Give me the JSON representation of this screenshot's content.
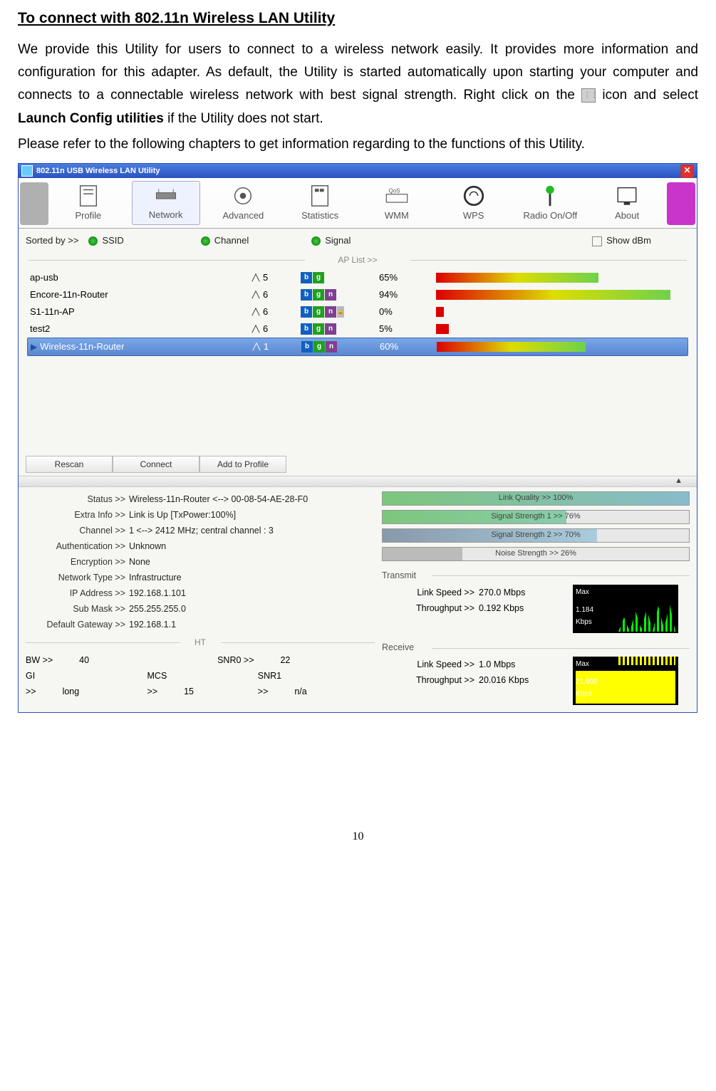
{
  "heading": "To connect with 802.11n Wireless LAN Utility",
  "intro": {
    "p1": "We provide this Utility for users to connect to a wireless network easily. It provides more information and configuration for this adapter. As default, the Utility is started automatically upon starting your computer and connects to a connectable wireless network with best signal strength. Right click on the ",
    "p1b": " icon and select ",
    "p1c": "Launch Config utilities",
    "p1d": " if the Utility does not start.",
    "p2": "Please refer to the following chapters to get information regarding to the functions of this Utility."
  },
  "window": {
    "title": "802.11n USB Wireless LAN Utility",
    "tabs": [
      "Profile",
      "Network",
      "Advanced",
      "Statistics",
      "WMM",
      "WPS",
      "Radio On/Off",
      "About"
    ],
    "sortLabel": "Sorted by >>",
    "sortOpts": [
      "SSID",
      "Channel",
      "Signal"
    ],
    "showDbm": "Show dBm",
    "aplistHeader": "AP List >>",
    "aps": [
      {
        "ssid": "ap-usb",
        "ch": "5",
        "modes": [
          "b",
          "g"
        ],
        "lock": false,
        "pct": "65%",
        "bar": 65
      },
      {
        "ssid": "Encore-11n-Router",
        "ch": "6",
        "modes": [
          "b",
          "g",
          "n"
        ],
        "lock": false,
        "pct": "94%",
        "bar": 94
      },
      {
        "ssid": "S1-11n-AP",
        "ch": "6",
        "modes": [
          "b",
          "g",
          "n"
        ],
        "lock": true,
        "pct": "0%",
        "bar": 0
      },
      {
        "ssid": "test2",
        "ch": "6",
        "modes": [
          "b",
          "g",
          "n"
        ],
        "lock": false,
        "pct": "5%",
        "bar": 5
      },
      {
        "ssid": "Wireless-11n-Router",
        "ch": "1",
        "modes": [
          "b",
          "g",
          "n"
        ],
        "lock": false,
        "pct": "60%",
        "bar": 60
      }
    ],
    "buttons": [
      "Rescan",
      "Connect",
      "Add to Profile"
    ],
    "details": {
      "Status": "Wireless-11n-Router <--> 00-08-54-AE-28-F0",
      "ExtraInfo": "Link is Up [TxPower:100%]",
      "Channel": "1 <--> 2412 MHz; central channel : 3",
      "Authentication": "Unknown",
      "Encryption": "None",
      "NetworkType": "Infrastructure",
      "IPAddress": "192.168.1.101",
      "SubMask": "255.255.255.0",
      "DefaultGateway": "192.168.1.1"
    },
    "ht": {
      "header": "HT",
      "BW": "40",
      "GI": "long",
      "MCS": "15",
      "SNR0": "22",
      "SNR1": "n/a"
    },
    "meters": {
      "linkQuality": "Link Quality >> 100%",
      "sig1": "Signal Strength 1 >> 76%",
      "sig2": "Signal Strength 2 >> 70%",
      "noise": "Noise Strength >> 26%"
    },
    "transmit": {
      "title": "Transmit",
      "linkSpeed": "270.0 Mbps",
      "throughput": "0.192 Kbps",
      "max": "Max",
      "maxval": "1.184",
      "unit": "Kbps"
    },
    "receive": {
      "title": "Receive",
      "linkSpeed": "1.0 Mbps",
      "throughput": "20.016 Kbps",
      "max": "Max",
      "maxval": "21.900",
      "unit": "Kbps"
    },
    "kvlabels": {
      "Status": "Status >>",
      "ExtraInfo": "Extra Info >>",
      "Channel": "Channel >>",
      "Authentication": "Authentication >>",
      "Encryption": "Encryption >>",
      "NetworkType": "Network Type >>",
      "IPAddress": "IP Address >>",
      "SubMask": "Sub Mask >>",
      "DefaultGateway": "Default Gateway >>",
      "LinkSpeed": "Link Speed >>",
      "Throughput": "Throughput >>",
      "BW": "BW >>",
      "GI": "GI >>",
      "MCS": "MCS >>",
      "SNR0": "SNR0 >>",
      "SNR1": "SNR1 >>"
    }
  },
  "pageNumber": "10"
}
